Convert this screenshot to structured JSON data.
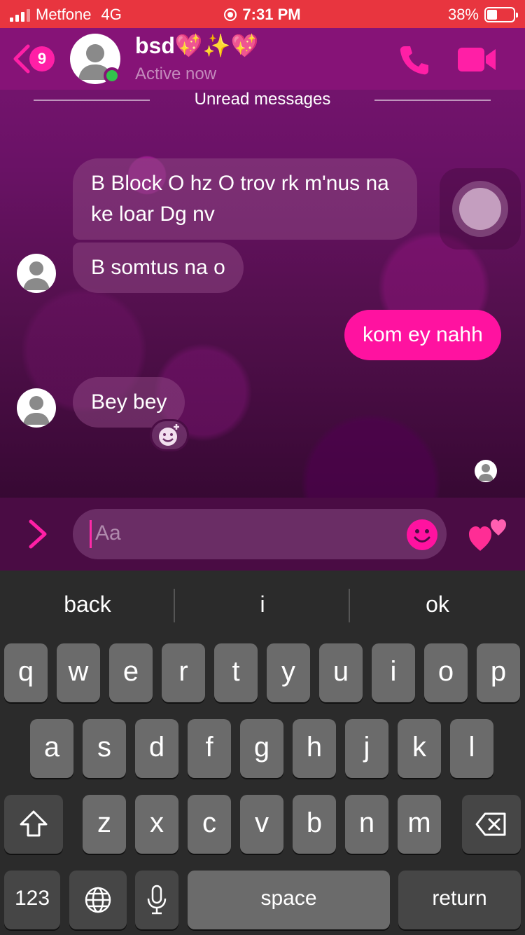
{
  "status_bar": {
    "carrier": "Metfone",
    "network": "4G",
    "time": "7:31 PM",
    "battery": "38%",
    "battery_level": 0.38
  },
  "header": {
    "back_badge": "9",
    "contact_name": "bsd💖✨💖",
    "presence": "Active now"
  },
  "unread_label": "Unread messages",
  "messages": [
    {
      "direction": "incoming",
      "text": "B Block O hz O trov rk m'nus na ke loar Dg nv"
    },
    {
      "direction": "incoming",
      "text": "B somtus na o"
    },
    {
      "direction": "outgoing",
      "text": "kom ey nahh"
    },
    {
      "direction": "incoming",
      "text": "Bey bey"
    }
  ],
  "composer": {
    "placeholder": "Aa"
  },
  "keyboard": {
    "suggestions": [
      "back",
      "i",
      "ok"
    ],
    "row1": [
      "q",
      "w",
      "e",
      "r",
      "t",
      "y",
      "u",
      "i",
      "o",
      "p"
    ],
    "row2": [
      "a",
      "s",
      "d",
      "f",
      "g",
      "h",
      "j",
      "k",
      "l"
    ],
    "row3": [
      "z",
      "x",
      "c",
      "v",
      "b",
      "n",
      "m"
    ],
    "numbers_label": "123",
    "space_label": "space",
    "return_label": "return"
  },
  "colors": {
    "accent": "#ff12a0",
    "status_bar": "#e8353f",
    "header": "#861377",
    "online": "#33c24d"
  },
  "icons": [
    "signal-icon",
    "record-icon",
    "battery-icon",
    "back-chevron-icon",
    "phone-icon",
    "video-camera-icon",
    "avatar-icon",
    "add-reaction-icon",
    "chevron-right-icon",
    "emoji-icon",
    "hearts-icon",
    "shift-icon",
    "backspace-icon",
    "globe-icon",
    "microphone-icon"
  ]
}
